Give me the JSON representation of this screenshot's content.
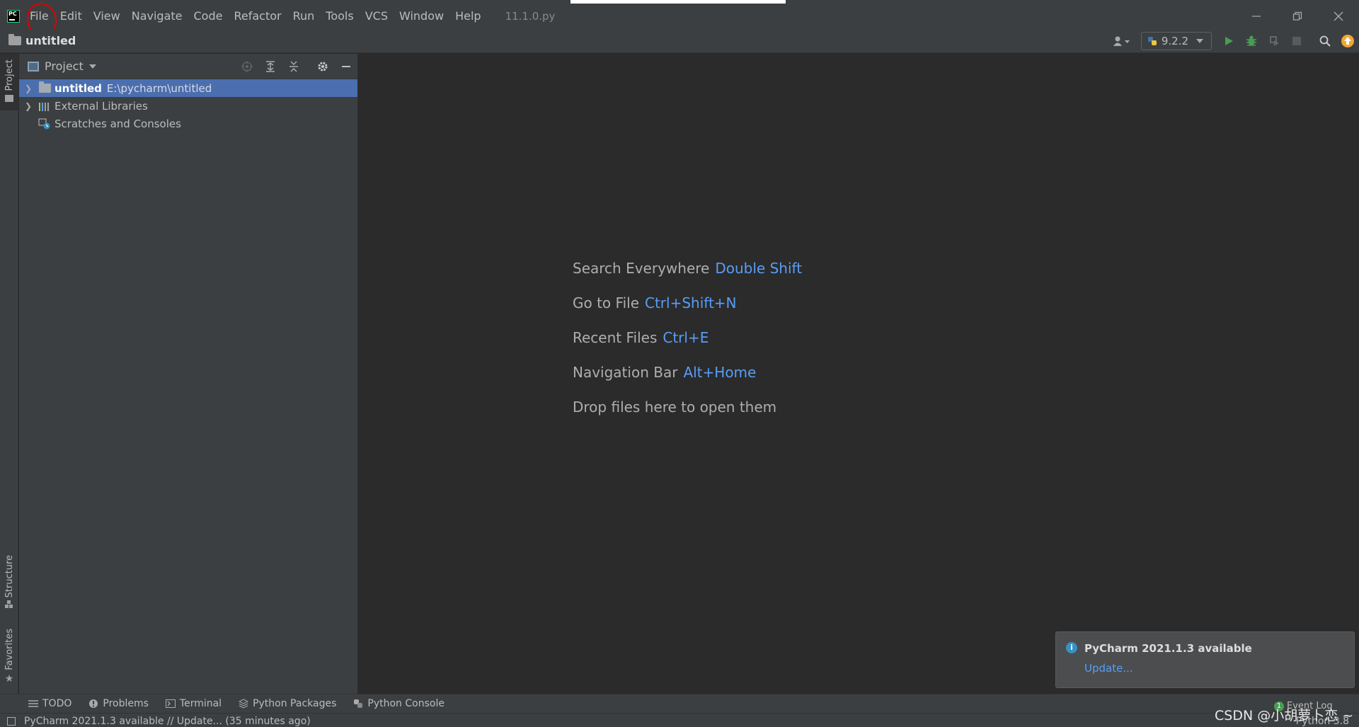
{
  "menubar": {
    "items": [
      "File",
      "Edit",
      "View",
      "Navigate",
      "Code",
      "Refactor",
      "Run",
      "Tools",
      "VCS",
      "Window",
      "Help"
    ],
    "file_title": "11.1.0.py"
  },
  "navbar": {
    "project_name": "untitled",
    "interpreter": "9.2.2"
  },
  "left_stripe": {
    "project_tab": "Project",
    "structure_tab": "Structure",
    "favorites_tab": "Favorites"
  },
  "project_panel": {
    "title": "Project",
    "tree": [
      {
        "name": "untitled",
        "path": "E:\\pycharm\\untitled"
      },
      {
        "name": "External Libraries"
      },
      {
        "name": "Scratches and Consoles"
      }
    ]
  },
  "editor": {
    "hints": [
      {
        "label": "Search Everywhere",
        "key": "Double Shift"
      },
      {
        "label": "Go to File",
        "key": "Ctrl+Shift+N"
      },
      {
        "label": "Recent Files",
        "key": "Ctrl+E"
      },
      {
        "label": "Navigation Bar",
        "key": "Alt+Home"
      },
      {
        "label": "Drop files here to open them",
        "key": ""
      }
    ]
  },
  "notification": {
    "title": "PyCharm 2021.1.3 available",
    "link": "Update..."
  },
  "bottom_tabs": [
    "TODO",
    "Problems",
    "Terminal",
    "Python Packages",
    "Python Console"
  ],
  "status": {
    "message": "PyCharm 2021.1.3 available // Update... (35 minutes ago)",
    "python": "Python 3.8",
    "event_log": "Event Log",
    "event_count": "1"
  },
  "watermark": "CSDN @小胡萝卜恋 ~",
  "colors": {
    "background": "#2b2b2b",
    "panel": "#3c3f41",
    "selection": "#4b6eaf",
    "link": "#589df6",
    "run_green": "#499c54",
    "annotation_red": "#e00000"
  }
}
